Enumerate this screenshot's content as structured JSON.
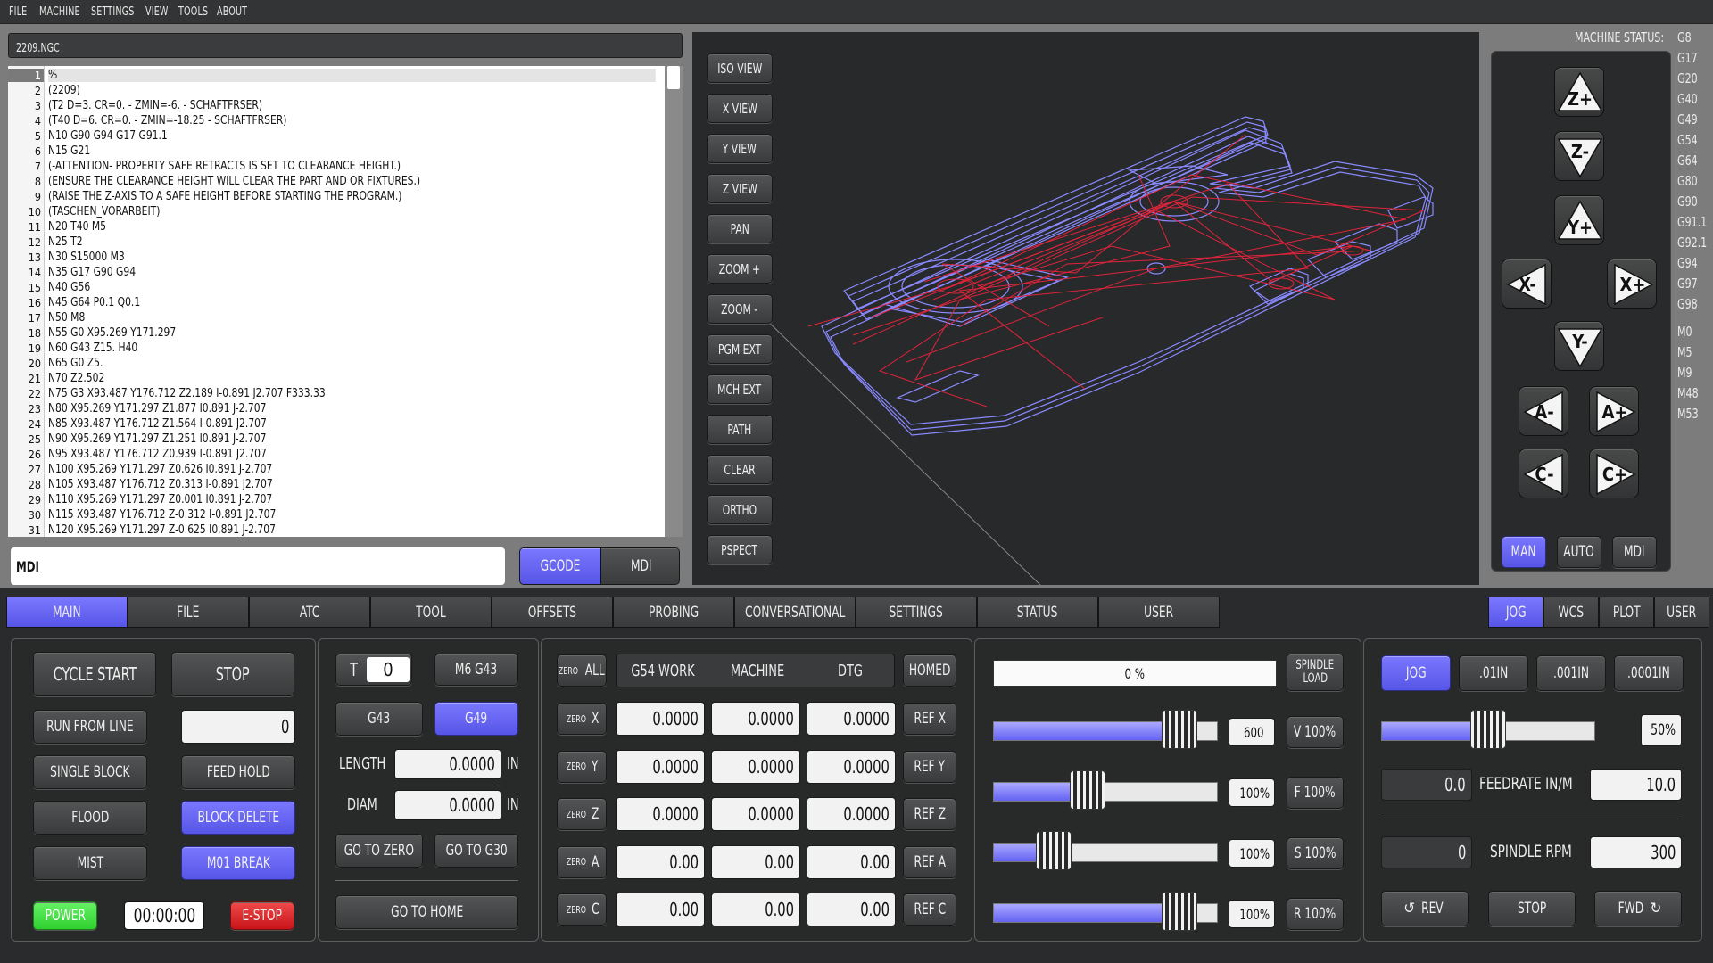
{
  "menu": [
    "FILE",
    "MACHINE",
    "SETTINGS",
    "VIEW",
    "TOOLS",
    "ABOUT"
  ],
  "program": {
    "filename": "2209.NGC",
    "lines": [
      "%",
      "(2209)",
      "(T2 D=3. CR=0. - ZMIN=-6. - SCHAFTFRSER)",
      "(T40 D=6. CR=0. - ZMIN=-18.25 - SCHAFTFRSER)",
      "N10 G90 G94 G17 G91.1",
      "N15 G21",
      "(-ATTENTION- PROPERTY SAFE RETRACTS IS SET TO CLEARANCE HEIGHT.)",
      "(ENSURE THE CLEARANCE HEIGHT WILL CLEAR THE PART AND OR FIXTURES.)",
      "(RAISE THE Z-AXIS TO A SAFE HEIGHT BEFORE STARTING THE PROGRAM.)",
      "(TASCHEN_VORARBEIT)",
      "N20 T40 M5",
      "N25 T2",
      "N30 S15000 M3",
      "N35 G17 G90 G94",
      "N40 G56",
      "N45 G64 P0.1 Q0.1",
      "N50 M8",
      "N55 G0 X95.269 Y171.297",
      "N60 G43 Z15. H40",
      "N65 G0 Z5.",
      "N70 Z2.502",
      "N75 G3 X93.487 Y176.712 Z2.189 I-0.891 J2.707 F333.33",
      "N80 X95.269 Y171.297 Z1.877 I0.891 J-2.707",
      "N85 X93.487 Y176.712 Z1.564 I-0.891 J2.707",
      "N90 X95.269 Y171.297 Z1.251 I0.891 J-2.707",
      "N95 X93.487 Y176.712 Z0.939 I-0.891 J2.707",
      "N100 X95.269 Y171.297 Z0.626 I0.891 J-2.707",
      "N105 X93.487 Y176.712 Z0.313 I-0.891 J2.707",
      "N110 X95.269 Y171.297 Z0.001 I0.891 J-2.707",
      "N115 X93.487 Y176.712 Z-0.312 I-0.891 J2.707",
      "N120 X95.269 Y171.297 Z-0.625 I0.891 J-2.707"
    ]
  },
  "mdi": {
    "value": "MDI",
    "tab_gcode": "GCODE",
    "tab_mdi": "MDI"
  },
  "view_buttons": [
    "ISO VIEW",
    "X VIEW",
    "Y VIEW",
    "Z VIEW",
    "PAN",
    "ZOOM +",
    "ZOOM -",
    "PGM EXT",
    "MCH EXT",
    "PATH",
    "CLEAR",
    "ORTHO",
    "PSPECT"
  ],
  "machine_status": {
    "label": "MACHINE STATUS:",
    "gcodes": [
      "G8",
      "G17",
      "G20",
      "G40",
      "G49",
      "G54",
      "G64",
      "G80",
      "G90",
      "G91.1",
      "G92.1",
      "G94",
      "G97",
      "G98"
    ],
    "mcodes": [
      "M0",
      "M5",
      "M9",
      "M48",
      "M53"
    ]
  },
  "jog": {
    "buttons": {
      "zp": "Z+",
      "zm": "Z-",
      "yp": "Y+",
      "xm": "X-",
      "xp": "X+",
      "ym": "Y-",
      "am": "A-",
      "ap": "A+",
      "cm": "C-",
      "cp": "C+"
    },
    "modes": [
      "MAN",
      "AUTO",
      "MDI"
    ]
  },
  "tabs": [
    "MAIN",
    "FILE",
    "ATC",
    "TOOL",
    "OFFSETS",
    "PROBING",
    "CONVERSATIONAL",
    "SETTINGS",
    "STATUS",
    "USER"
  ],
  "right_tabs": [
    "JOG",
    "WCS",
    "PLOT",
    "USER"
  ],
  "control": {
    "cycle_start": "CYCLE START",
    "stop": "STOP",
    "run_from_line": "RUN FROM LINE",
    "run_from_line_value": "0",
    "single_block": "SINGLE BLOCK",
    "feed_hold": "FEED HOLD",
    "flood": "FLOOD",
    "block_delete": "BLOCK DELETE",
    "mist": "MIST",
    "m01_break": "M01 BREAK",
    "power": "POWER",
    "timer": "00:00:00",
    "estop": "E-STOP"
  },
  "tool": {
    "t_label": "T",
    "t_value": "0",
    "m6_g43": "M6 G43",
    "g43": "G43",
    "g49": "G49",
    "length_label": "LENGTH",
    "length_value": "0.0000",
    "length_unit": "IN",
    "diam_label": "DIAM",
    "diam_value": "0.0000",
    "diam_unit": "IN",
    "go_to_zero": "GO TO ZERO",
    "go_to_g30": "GO TO G30",
    "go_to_home": "GO TO HOME"
  },
  "dro": {
    "zero_all_small": "ZERO",
    "zero_all": "ALL",
    "headers": [
      "G54 WORK",
      "MACHINE",
      "DTG"
    ],
    "homed": "HOMED",
    "rows": [
      {
        "axis": "X",
        "work": "0.0000",
        "machine": "0.0000",
        "dtg": "0.0000",
        "ref": "REF X"
      },
      {
        "axis": "Y",
        "work": "0.0000",
        "machine": "0.0000",
        "dtg": "0.0000",
        "ref": "REF Y"
      },
      {
        "axis": "Z",
        "work": "0.0000",
        "machine": "0.0000",
        "dtg": "0.0000",
        "ref": "REF Z"
      },
      {
        "axis": "A",
        "work": "0.00",
        "machine": "0.00",
        "dtg": "0.00",
        "ref": "REF A"
      },
      {
        "axis": "C",
        "work": "0.00",
        "machine": "0.00",
        "dtg": "0.00",
        "ref": "REF C"
      }
    ]
  },
  "overrides": {
    "spindle_load_value": "0 %",
    "spindle_load_label_1": "SPINDLE",
    "spindle_load_label_2": "LOAD",
    "rows": [
      {
        "value": "600",
        "button": "V 100%",
        "level": 0.83
      },
      {
        "value": "100%",
        "button": "F 100%",
        "level": 0.42
      },
      {
        "value": "100%",
        "button": "S 100%",
        "level": 0.27
      },
      {
        "value": "100%",
        "button": "R 100%",
        "level": 0.83
      }
    ]
  },
  "jogctl": {
    "jog": "JOG",
    "inc1": ".01IN",
    "inc2": ".001IN",
    "inc3": ".0001IN",
    "jog_rate": "50%",
    "jog_level": 0.5,
    "feed_actual": "0.0",
    "feed_label": "FEEDRATE IN/M",
    "feed_set": "10.0",
    "spindle_actual": "0",
    "spindle_label": "SPINDLE RPM",
    "spindle_set": "300",
    "rev": "REV",
    "stop": "STOP",
    "fwd": "FWD"
  },
  "colors": {
    "accent": "#6a68f5",
    "power": "#3ee03e",
    "estop": "#e8262a",
    "toolpath": "#e0243a",
    "model": "#7c7cff"
  }
}
